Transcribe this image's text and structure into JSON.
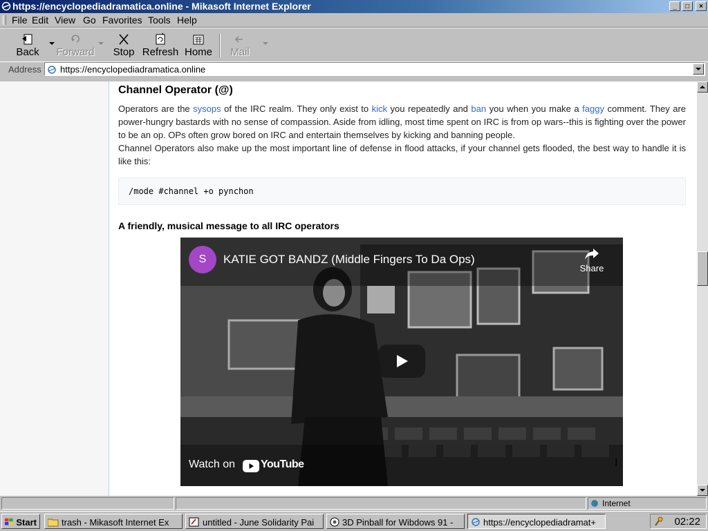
{
  "window": {
    "title": "https://encyclopediadramatica.online - Mikasoft Internet Explorer",
    "controls": [
      "_",
      "□",
      "×"
    ]
  },
  "menu": [
    "File",
    "Edit",
    "View",
    "Go",
    "Favorites",
    "Tools",
    "Help"
  ],
  "toolbar": {
    "back": "Back",
    "forward": "Forward",
    "stop": "Stop",
    "refresh": "Refresh",
    "home": "Home",
    "mail": "Mail"
  },
  "address": {
    "label": "Address",
    "url": "https://encyclopediadramatica.online"
  },
  "article": {
    "heading": "Channel Operator (@)",
    "p1": {
      "t1": "Operators are the ",
      "l1": "sysops",
      "t2": " of the IRC realm. They only exist to ",
      "l2": "kick",
      "t3": " you repeatedly and ",
      "l3": "ban",
      "t4": " you when you make a ",
      "l4": "faggy",
      "t5": " comment. They are power-hungry bastards with no sense of compassion. Aside from idling, most time spent on IRC is from op wars--this is fighting over the power to be an op. OPs often grow bored on IRC and entertain themselves by kicking and banning people."
    },
    "p2": "Channel Operators also make up the most important line of defense in flood attacks, if your channel gets flooded, the best way to handle it is like this:",
    "code": "/mode #channel +o pynchon",
    "subheading": "A friendly, musical message to all IRC operators"
  },
  "video": {
    "avatar_letter": "S",
    "title": "KATIE GOT BANDZ (Middle Fingers To Da Ops)",
    "share": "Share",
    "watch_on": "Watch on",
    "youtube": "YouTube"
  },
  "status": {
    "zone": "Internet"
  },
  "taskbar": {
    "start": "Start",
    "tasks": [
      "trash - Mikasoft Internet Ex",
      "untitled - June Solidarity Pai",
      "3D Pinball for Wibdows 91 -",
      "https://encyclopediadramat+"
    ],
    "clock": "02:22"
  }
}
